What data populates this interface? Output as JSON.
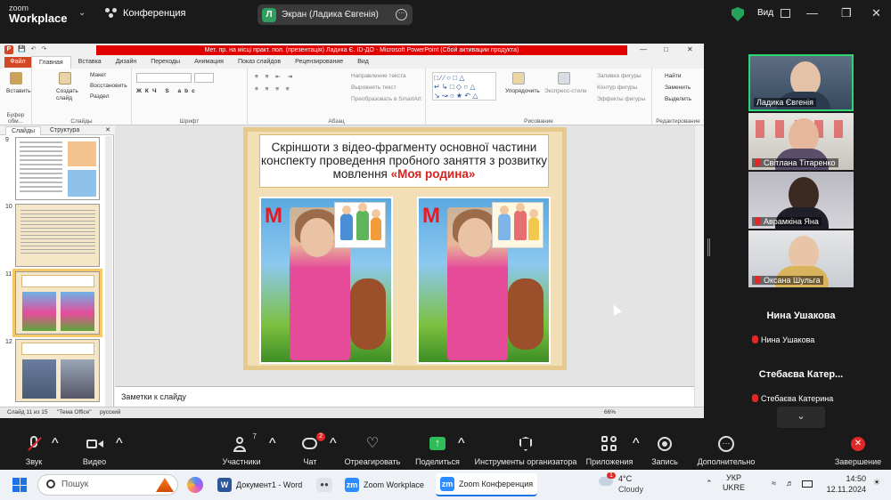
{
  "zoom": {
    "logo_top": "zoom",
    "logo_bottom": "Workplace",
    "meeting_label": "Конференция",
    "screen_share_avatar": "Л",
    "screen_share_label": "Экран (Ладика Євгенія)",
    "view_label": "Вид",
    "accent_color": "#2ed573"
  },
  "powerpoint": {
    "file_icon": "P",
    "window_title": "Мет. пр. на місці практ. пол. (презентація) Ладика Є. ІD-ДО  -  Microsoft PowerPoint (Сбой активации продукта)",
    "file_tab": "Файл",
    "tabs": [
      "Главная",
      "Вставка",
      "Дизайн",
      "Переходы",
      "Анимация",
      "Показ слайдов",
      "Рецензирование",
      "Вид"
    ],
    "ribbon": {
      "clipboard": {
        "paste": "Вставить",
        "group": "Буфер обм..."
      },
      "slides": {
        "create": "Создать слайд",
        "layout": "Макет",
        "restore": "Восстановить",
        "section": "Раздел",
        "group": "Слайды"
      },
      "font": {
        "group": "Шрифт"
      },
      "paragraph": {
        "direction": "Направление текста",
        "align": "Выровнять текст",
        "smartart": "Преобразовать в SmartArt",
        "group": "Абзац"
      },
      "drawing": {
        "arrange": "Упорядочить",
        "styles": "Экспресс-стили",
        "fill": "Заливка фигуры",
        "outline": "Контур фигуры",
        "effects": "Эффекты фигуры",
        "group": "Рисование"
      },
      "editing": {
        "find": "Найти",
        "replace": "Заменить",
        "select": "Выделить",
        "group": "Редактирование"
      }
    },
    "panel_tabs": {
      "slides": "Слайды",
      "outline": "Структура"
    },
    "thumbnails": [
      {
        "num": "9"
      },
      {
        "num": "10"
      },
      {
        "num": "11"
      },
      {
        "num": "12"
      }
    ],
    "slide": {
      "title_main": "Скріншоти  з відео-фрагменту основної частини конспекту проведення пробного заняття з розвитку мовлення ",
      "title_highlight": "«Моя родина»",
      "photo_letter": "М"
    },
    "notes_placeholder": "Заметки к слайду",
    "status": {
      "slide": "Слайд 11 из 15",
      "theme": "\"Тема Office\"",
      "language": "русский",
      "zoom": "66%"
    }
  },
  "participants": [
    {
      "name": "Ладика Євгенія",
      "video": true,
      "muted": false,
      "active": true
    },
    {
      "name": "Світлана Тітаренко",
      "video": true,
      "muted": true,
      "active": false
    },
    {
      "name": "Аврамкіна Яна",
      "video": true,
      "muted": true,
      "active": false
    },
    {
      "name": "Оксана Шульга",
      "video": true,
      "muted": true,
      "active": false
    },
    {
      "big_name": "Нина Ушакова",
      "name": "Нина Ушакова",
      "video": false,
      "muted": true
    },
    {
      "big_name": "Стебаєва Катер...",
      "name": "Стебаєва Катерина",
      "video": false,
      "muted": true
    }
  ],
  "toolbar": {
    "audio": "Звук",
    "video": "Видео",
    "participants": "Участники",
    "participants_count": "7",
    "chat": "Чат",
    "chat_badge": "2",
    "react": "Отреагировать",
    "share": "Поделиться",
    "host_tools": "Инструменты организатора",
    "apps": "Приложения",
    "record": "Запись",
    "more": "Дополнительно",
    "end": "Завершение"
  },
  "taskbar": {
    "search_placeholder": "Пошук",
    "apps": [
      {
        "label": "Документ1 - Word",
        "icon": "W",
        "color": "#2b579a"
      },
      {
        "label": "Zoom Workplace",
        "icon": "zm",
        "color": "#2d8cff"
      },
      {
        "label": "Zoom Конференция",
        "icon": "zm",
        "color": "#2d8cff"
      }
    ],
    "weather_temp": "4°C",
    "weather_desc": "Cloudy",
    "weather_badge": "1",
    "language_top": "УКР",
    "language_bottom": "UKRE",
    "time": "14:50",
    "date": "12.11.2024"
  }
}
